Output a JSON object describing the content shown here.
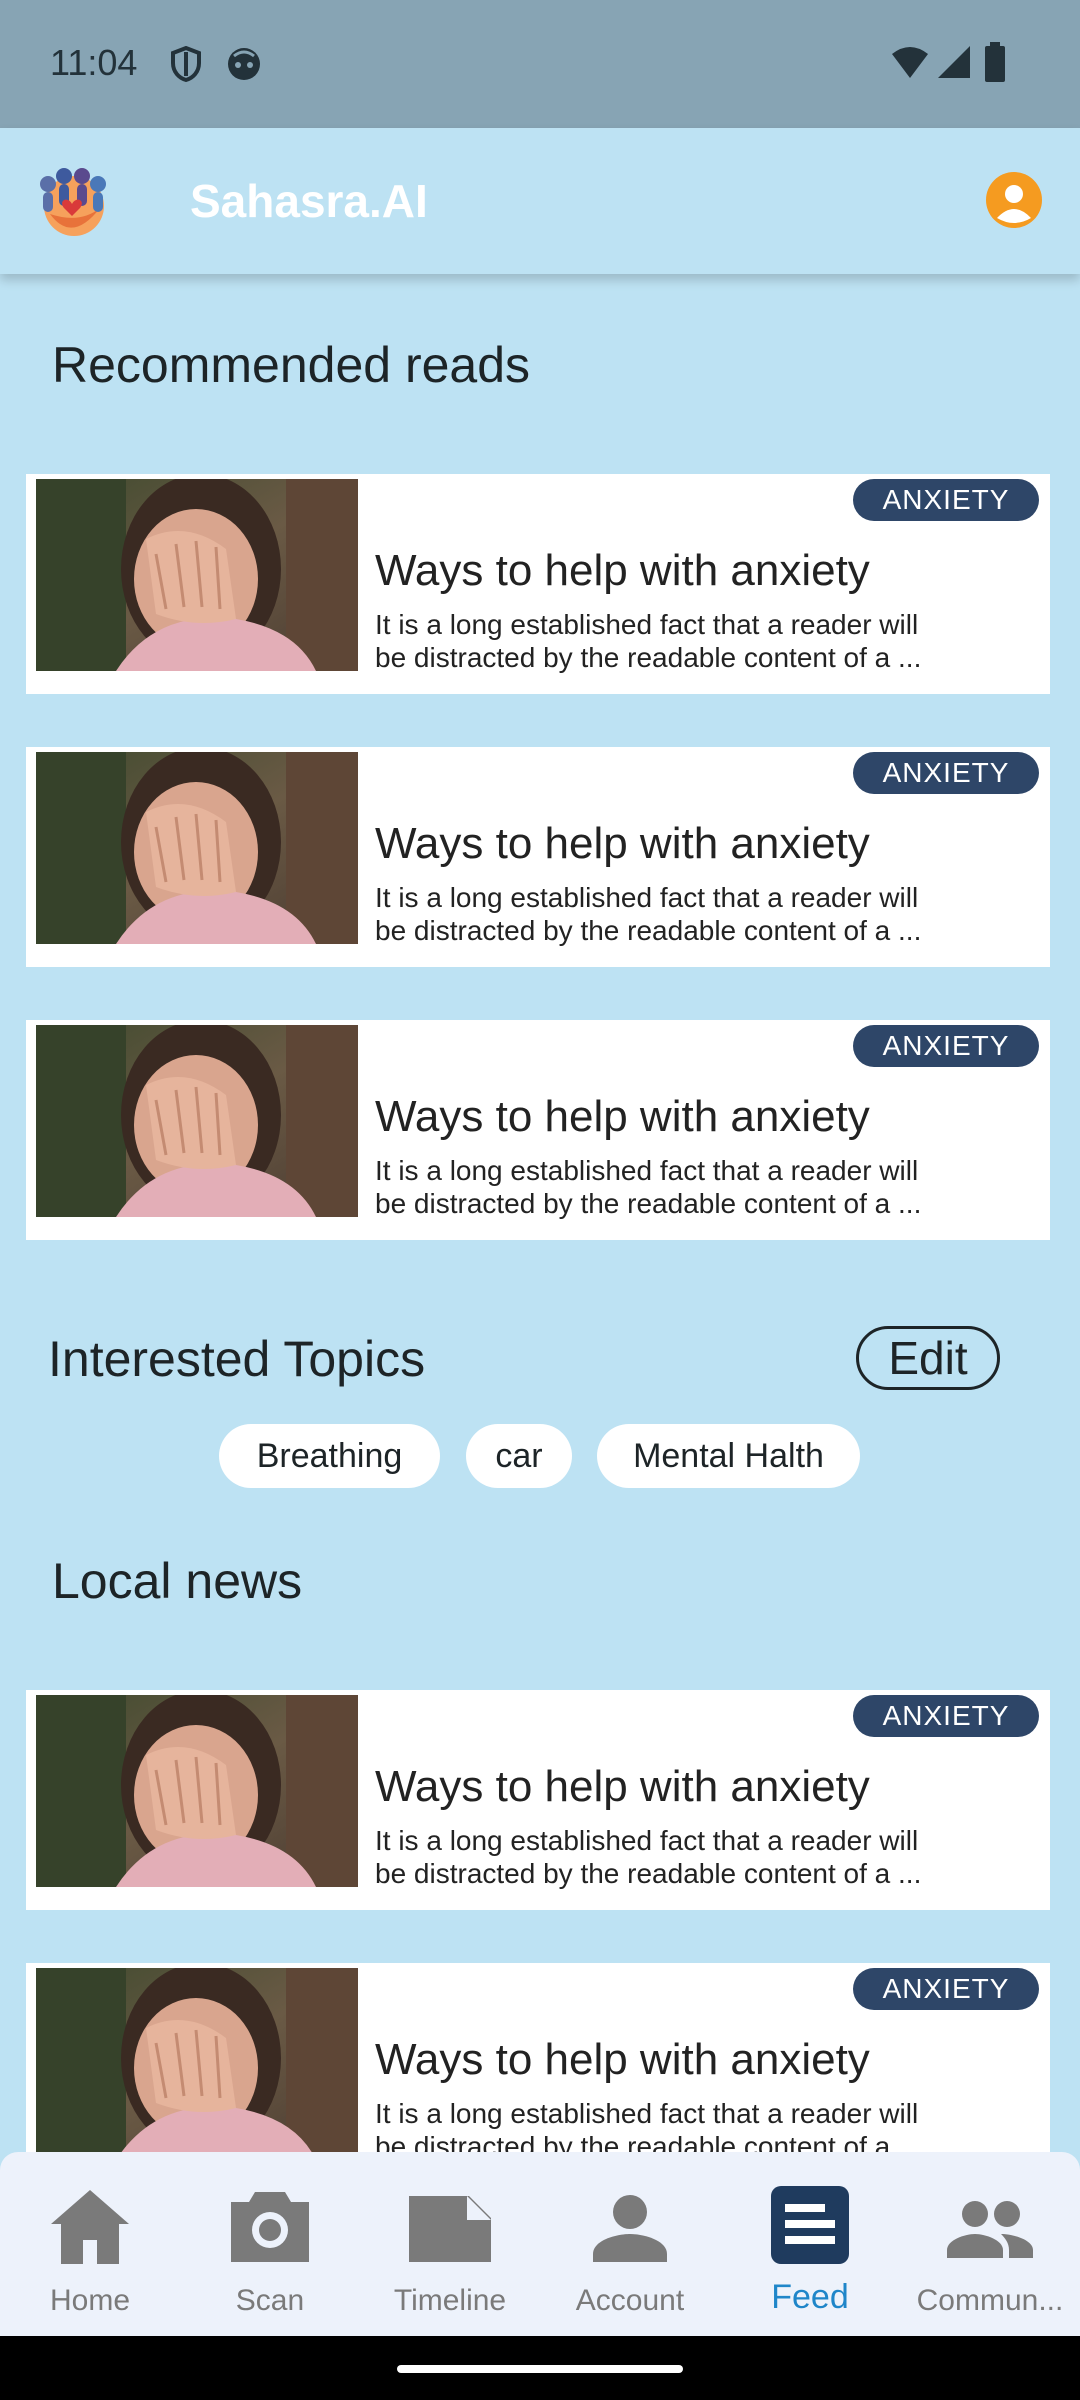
{
  "status_bar": {
    "time": "11:04"
  },
  "app_bar": {
    "title": "Sahasra.AI"
  },
  "recommended": {
    "title": "Recommended reads",
    "articles": [
      {
        "badge": "ANXIETY",
        "title": "Ways to help with anxiety",
        "desc_line1": "It is a long established fact that a reader will",
        "desc_line2": "be distracted by the readable content of a ..."
      },
      {
        "badge": "ANXIETY",
        "title": "Ways to help with anxiety",
        "desc_line1": "It is a long established fact that a reader will",
        "desc_line2": "be distracted by the readable content of a ..."
      },
      {
        "badge": "ANXIETY",
        "title": "Ways to help with anxiety",
        "desc_line1": "It is a long established fact that a reader will",
        "desc_line2": "be distracted by the readable content of a ..."
      }
    ]
  },
  "topics": {
    "title": "Interested Topics",
    "edit_label": "Edit",
    "chips": [
      "Breathing",
      "car",
      "Mental Halth"
    ]
  },
  "local_news": {
    "title": "Local news",
    "articles": [
      {
        "badge": "ANXIETY",
        "title": "Ways to help with anxiety",
        "desc_line1": "It is a long established fact that a reader will",
        "desc_line2": "be distracted by the readable content of a ..."
      },
      {
        "badge": "ANXIETY",
        "title": "Ways to help with anxiety",
        "desc_line1": "It is a long established fact that a reader will",
        "desc_line2": "be distracted by the readable content of a ..."
      }
    ]
  },
  "bottom_nav": {
    "items": [
      {
        "label": "Home",
        "icon": "home-icon"
      },
      {
        "label": "Scan",
        "icon": "camera-icon"
      },
      {
        "label": "Timeline",
        "icon": "timeline-icon"
      },
      {
        "label": "Account",
        "icon": "person-icon"
      },
      {
        "label": "Feed",
        "icon": "article-icon"
      },
      {
        "label": "Commun...",
        "icon": "people-icon"
      }
    ],
    "active": "Feed"
  },
  "colors": {
    "background": "#bde2f3",
    "status_bar": "#87a4b4",
    "badge": "#2e4668",
    "avatar": "#f59b20",
    "nav_active": "#1f86c9",
    "nav_inactive": "#7a7a7a"
  }
}
